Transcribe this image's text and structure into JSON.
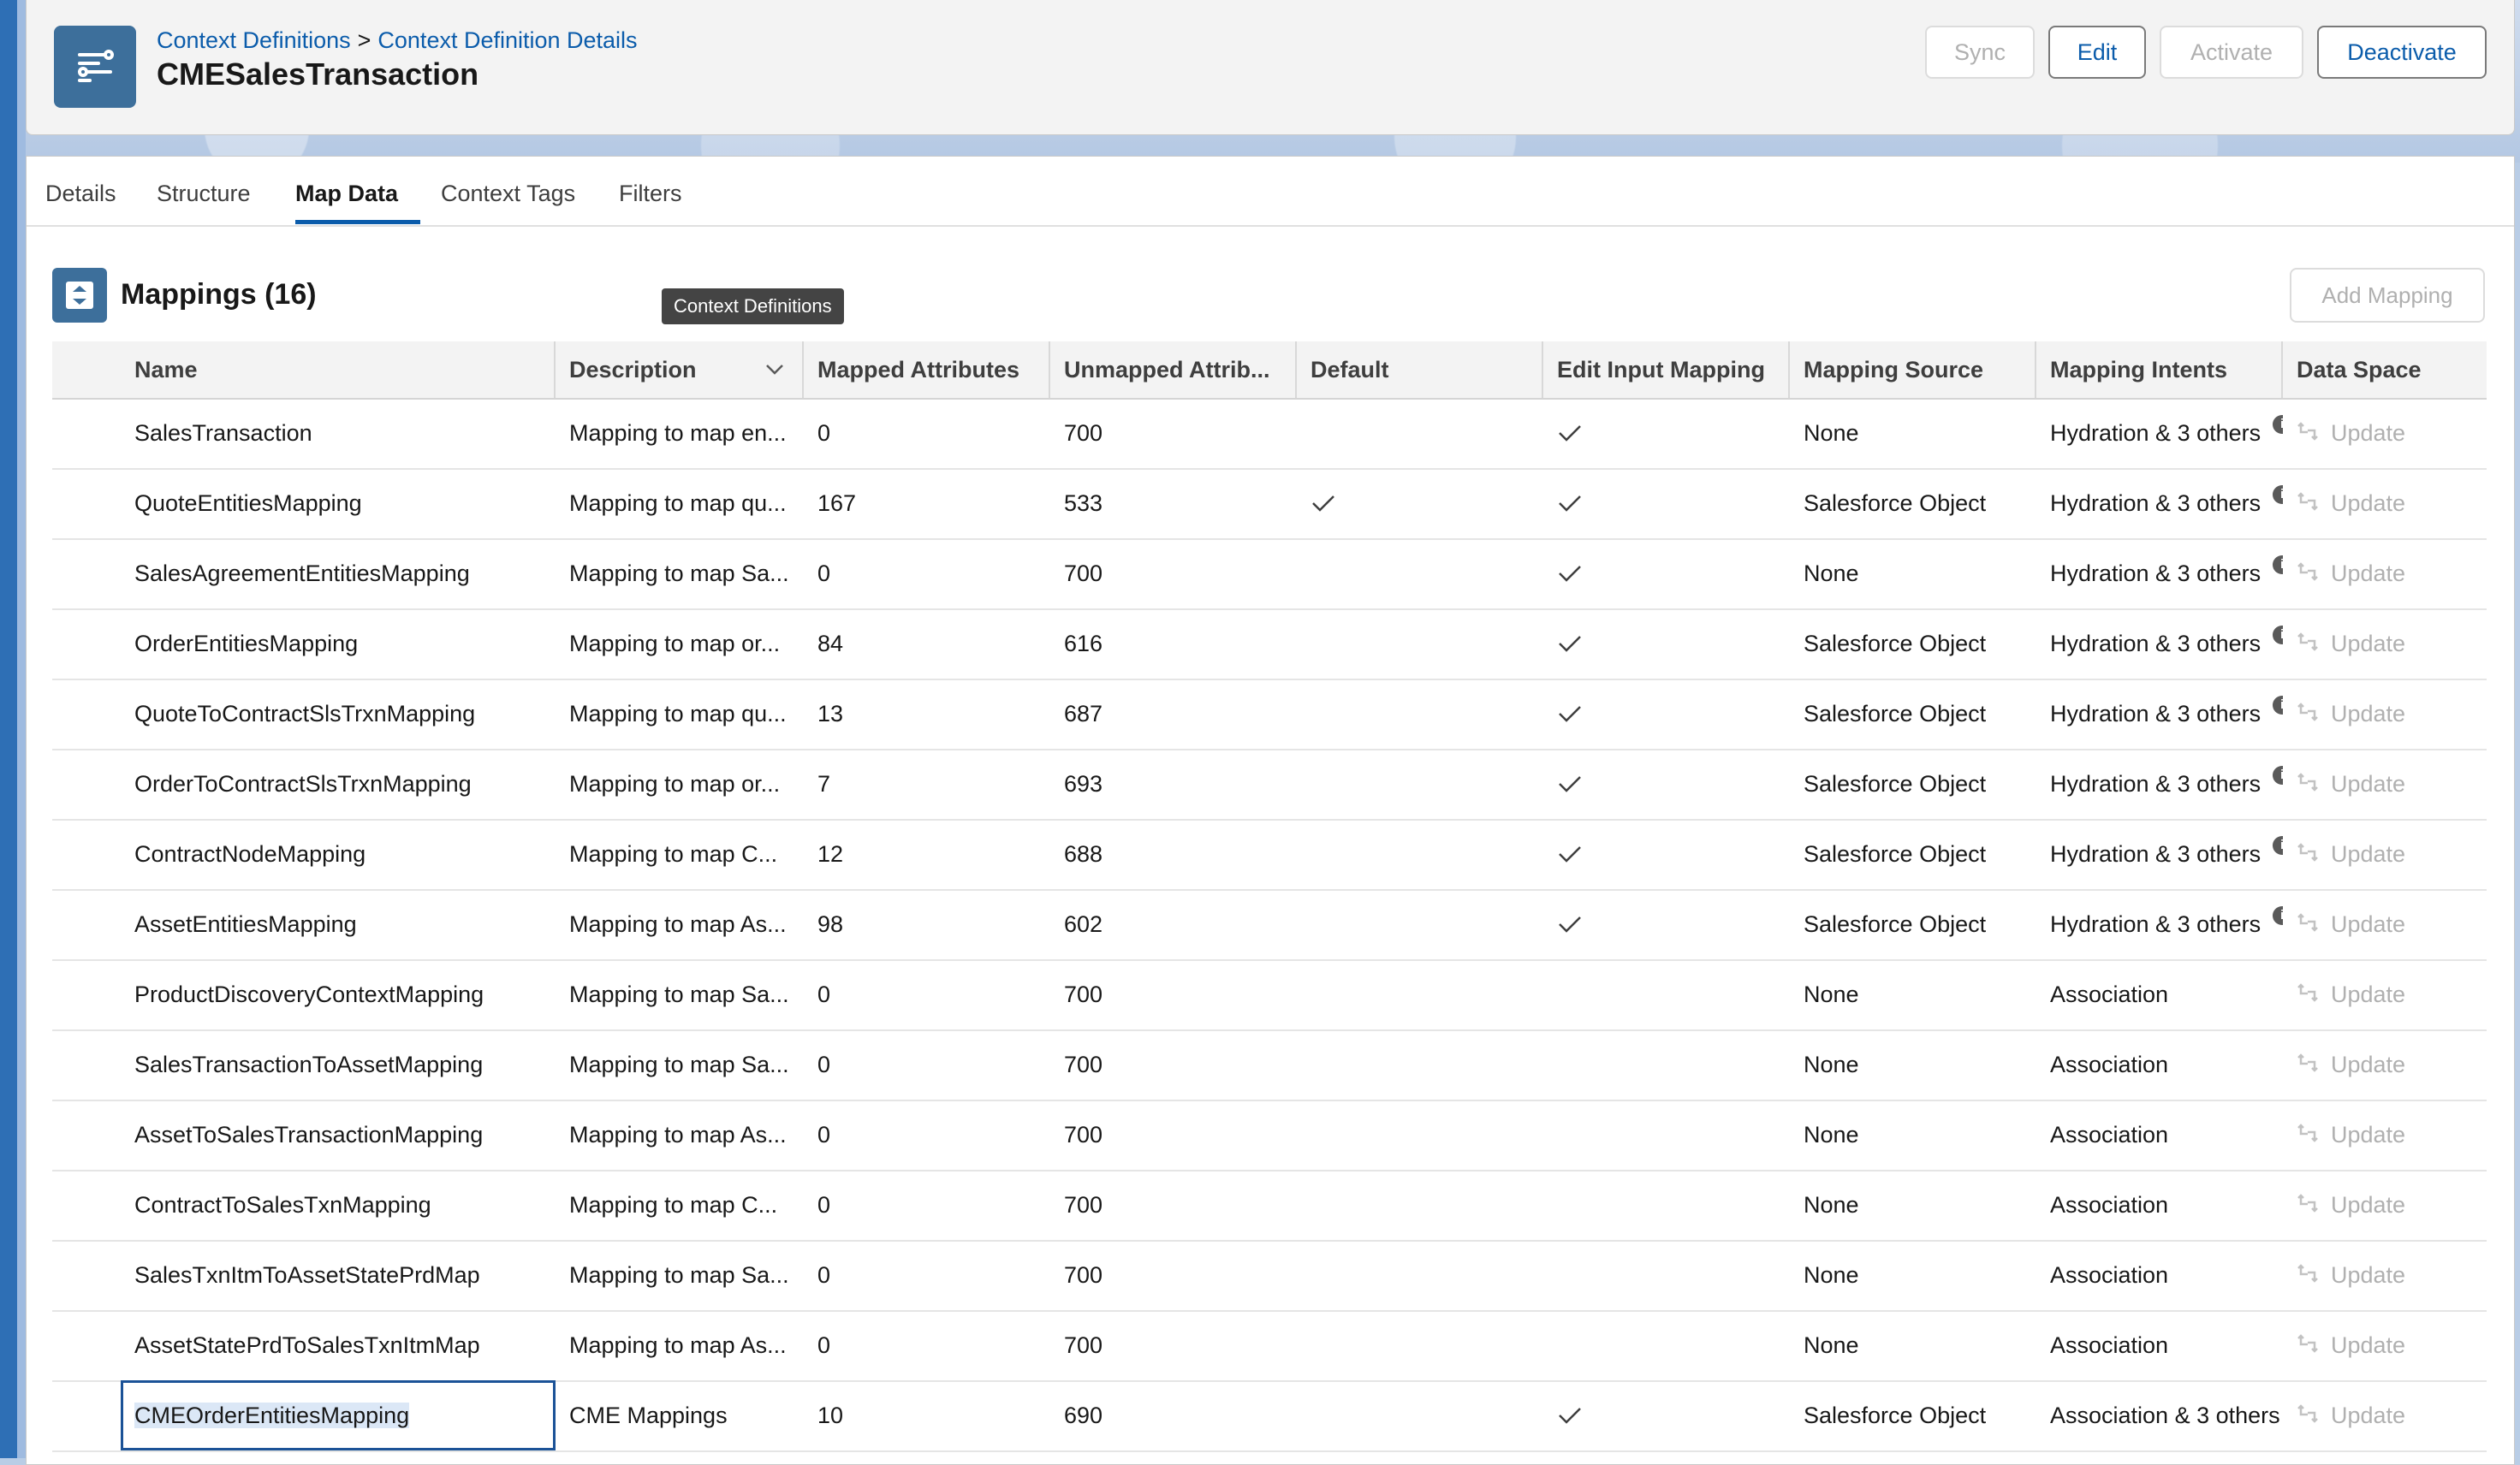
{
  "header": {
    "breadcrumb_parent": "Context Definitions",
    "breadcrumb_sep": ">",
    "breadcrumb_current": "Context Definition Details",
    "title": "CMESalesTransaction",
    "buttons": {
      "sync": "Sync",
      "edit": "Edit",
      "activate": "Activate",
      "deactivate": "Deactivate"
    }
  },
  "tabs": [
    "Details",
    "Structure",
    "Map Data",
    "Context Tags",
    "Filters"
  ],
  "active_tab": "Map Data",
  "section": {
    "title": "Mappings (16)",
    "add_button": "Add Mapping",
    "tooltip": "Context Definitions"
  },
  "columns": [
    "Name",
    "Description",
    "Mapped Attributes",
    "Unmapped Attrib...",
    "Default",
    "Edit Input Mapping",
    "Mapping Source",
    "Mapping Intents",
    "Data Space"
  ],
  "update_label": "Update",
  "rows": [
    {
      "name": "SalesTransaction",
      "description": "Mapping to map en...",
      "mapped": "0",
      "unmapped": "700",
      "default": false,
      "edit_input": true,
      "source": "None",
      "intents": "Hydration & 3 others",
      "intents_info": true
    },
    {
      "name": "QuoteEntitiesMapping",
      "description": "Mapping to map qu...",
      "mapped": "167",
      "unmapped": "533",
      "default": true,
      "edit_input": true,
      "source": "Salesforce Object",
      "intents": "Hydration & 3 others",
      "intents_info": true
    },
    {
      "name": "SalesAgreementEntitiesMapping",
      "description": "Mapping to map Sa...",
      "mapped": "0",
      "unmapped": "700",
      "default": false,
      "edit_input": true,
      "source": "None",
      "intents": "Hydration & 3 others",
      "intents_info": true
    },
    {
      "name": "OrderEntitiesMapping",
      "description": "Mapping to map or...",
      "mapped": "84",
      "unmapped": "616",
      "default": false,
      "edit_input": true,
      "source": "Salesforce Object",
      "intents": "Hydration & 3 others",
      "intents_info": true
    },
    {
      "name": "QuoteToContractSlsTrxnMapping",
      "description": "Mapping to map qu...",
      "mapped": "13",
      "unmapped": "687",
      "default": false,
      "edit_input": true,
      "source": "Salesforce Object",
      "intents": "Hydration & 3 others",
      "intents_info": true
    },
    {
      "name": "OrderToContractSlsTrxnMapping",
      "description": "Mapping to map or...",
      "mapped": "7",
      "unmapped": "693",
      "default": false,
      "edit_input": true,
      "source": "Salesforce Object",
      "intents": "Hydration & 3 others",
      "intents_info": true
    },
    {
      "name": "ContractNodeMapping",
      "description": "Mapping to map C...",
      "mapped": "12",
      "unmapped": "688",
      "default": false,
      "edit_input": true,
      "source": "Salesforce Object",
      "intents": "Hydration & 3 others",
      "intents_info": true
    },
    {
      "name": "AssetEntitiesMapping",
      "description": "Mapping to map As...",
      "mapped": "98",
      "unmapped": "602",
      "default": false,
      "edit_input": true,
      "source": "Salesforce Object",
      "intents": "Hydration & 3 others",
      "intents_info": true
    },
    {
      "name": "ProductDiscoveryContextMapping",
      "description": "Mapping to map Sa...",
      "mapped": "0",
      "unmapped": "700",
      "default": false,
      "edit_input": false,
      "source": "None",
      "intents": "Association",
      "intents_info": false
    },
    {
      "name": "SalesTransactionToAssetMapping",
      "description": "Mapping to map Sa...",
      "mapped": "0",
      "unmapped": "700",
      "default": false,
      "edit_input": false,
      "source": "None",
      "intents": "Association",
      "intents_info": false
    },
    {
      "name": "AssetToSalesTransactionMapping",
      "description": "Mapping to map As...",
      "mapped": "0",
      "unmapped": "700",
      "default": false,
      "edit_input": false,
      "source": "None",
      "intents": "Association",
      "intents_info": false
    },
    {
      "name": "ContractToSalesTxnMapping",
      "description": "Mapping to map C...",
      "mapped": "0",
      "unmapped": "700",
      "default": false,
      "edit_input": false,
      "source": "None",
      "intents": "Association",
      "intents_info": false
    },
    {
      "name": "SalesTxnItmToAssetStatePrdMap",
      "description": "Mapping to map Sa...",
      "mapped": "0",
      "unmapped": "700",
      "default": false,
      "edit_input": false,
      "source": "None",
      "intents": "Association",
      "intents_info": false
    },
    {
      "name": "AssetStatePrdToSalesTxnItmMap",
      "description": "Mapping to map As...",
      "mapped": "0",
      "unmapped": "700",
      "default": false,
      "edit_input": false,
      "source": "None",
      "intents": "Association",
      "intents_info": false
    },
    {
      "name": "CMEOrderEntitiesMapping",
      "description": "CME Mappings",
      "mapped": "10",
      "unmapped": "690",
      "default": false,
      "edit_input": true,
      "source": "Salesforce Object",
      "intents": "Association & 3 others",
      "intents_info": true,
      "selected": true
    }
  ],
  "colors": {
    "brand": "#0b5cab",
    "icon_bg": "#3d6f9b"
  }
}
